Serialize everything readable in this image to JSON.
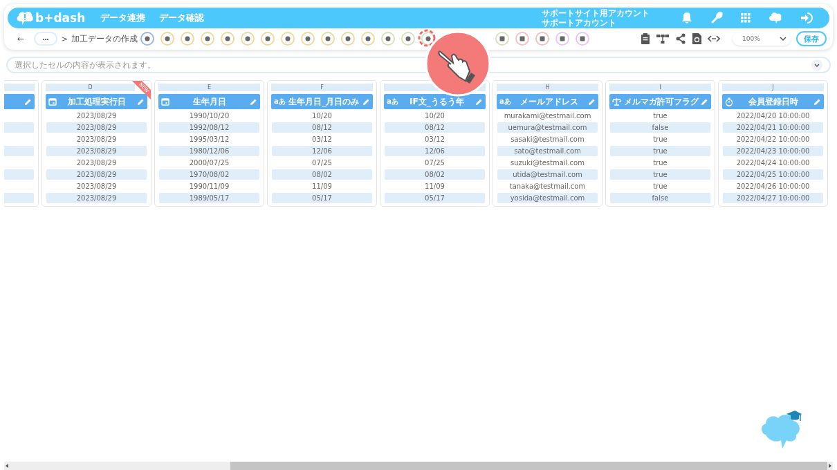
{
  "header": {
    "logo": "b+dash",
    "nav": [
      {
        "label": "データ連携"
      },
      {
        "label": "データ確認"
      }
    ],
    "account": {
      "site": "サポートサイト用アカウント",
      "name": "サポートアカウント"
    }
  },
  "toolbar": {
    "back": "←",
    "more": "•••",
    "separator": ">",
    "breadcrumb": "加工データの作成",
    "zoom": "100%",
    "save": "保存"
  },
  "formula_bar": {
    "placeholder": "選択したセルの内容が表示されます。"
  },
  "columns": [
    {
      "letter": "D",
      "title": "加工処理実行日",
      "kind": "date",
      "badge": "NEW",
      "cells": [
        "2023/08/29",
        "2023/08/29",
        "2023/08/29",
        "2023/08/29",
        "2023/08/29",
        "2023/08/29",
        "2023/08/29",
        "2023/08/29"
      ]
    },
    {
      "letter": "E",
      "title": "生年月日",
      "kind": "date",
      "cells": [
        "1990/10/20",
        "1992/08/12",
        "1995/03/12",
        "1980/12/06",
        "2000/07/25",
        "1970/08/02",
        "1990/11/09",
        "1989/05/17"
      ]
    },
    {
      "letter": "F",
      "title": "生年月日_月日のみ",
      "kind": "text",
      "type_label": "aあ",
      "cells": [
        "10/20",
        "08/12",
        "03/12",
        "12/06",
        "07/25",
        "08/02",
        "11/09",
        "05/17"
      ]
    },
    {
      "title": "IF文_うるう年",
      "kind": "text",
      "type_label": "aあ",
      "cells": [
        "10/20",
        "08/12",
        "03/12",
        "12/06",
        "07/25",
        "08/02",
        "11/09",
        "05/17"
      ]
    },
    {
      "letter": "H",
      "title": "メールアドレス",
      "kind": "text",
      "type_label": "aあ",
      "cells": [
        "murakami@testmail.com",
        "uemura@testmail.com",
        "sasaki@testmail.com",
        "sato@testmail.com",
        "suzuki@testmail.com",
        "utida@testmail.com",
        "tanaka@testmail.com",
        "yosida@testmail.com"
      ]
    },
    {
      "letter": "I",
      "title": "メルマガ許可フラグ",
      "kind": "bool",
      "cells": [
        "true",
        "false",
        "true",
        "true",
        "true",
        "true",
        "true",
        "false"
      ]
    },
    {
      "letter": "J",
      "title": "会員登録日時",
      "kind": "datetime",
      "cells": [
        "2022/04/20 10:00:00",
        "2022/04/21 10:00:00",
        "2022/04/22 10:00:00",
        "2022/04/23 10:00:00",
        "2022/04/24 10:00:00",
        "2022/04/25 10:00:00",
        "2022/04/26 10:00:00",
        "2022/04/27 10:00:00"
      ]
    }
  ]
}
